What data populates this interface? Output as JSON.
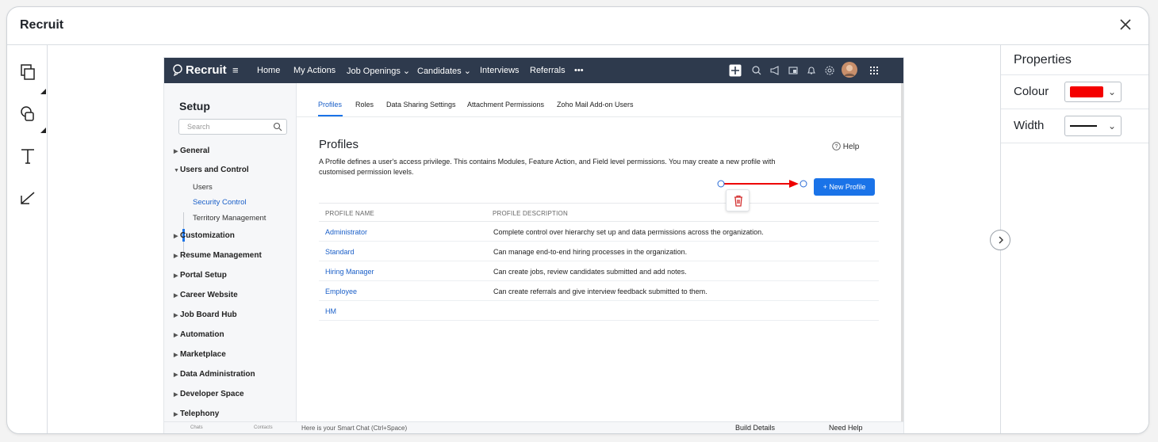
{
  "window": {
    "title": "Recruit",
    "close_icon": "close-icon"
  },
  "toolbar": {
    "tools": [
      "layers-copy-icon",
      "shapes-icon",
      "text-icon",
      "pen-icon"
    ]
  },
  "properties": {
    "title": "Properties",
    "colour_label": "Colour",
    "colour_value": "#f40000",
    "width_label": "Width"
  },
  "zoho": {
    "logo": "Recruit",
    "nav": [
      "Home",
      "My Actions",
      "Job Openings ⌄",
      "Candidates ⌄",
      "Interviews",
      "Referrals",
      "•••"
    ],
    "sidebar": {
      "title": "Setup",
      "search_placeholder": "Search",
      "menu": [
        "General",
        "Users and Control",
        "Customization",
        "Resume Management",
        "Portal Setup",
        "Career Website",
        "Job Board Hub",
        "Automation",
        "Marketplace",
        "Data Administration",
        "Developer Space",
        "Telephony"
      ],
      "submenu": [
        "Users",
        "Security Control",
        "Territory Management"
      ]
    },
    "tabs": [
      "Profiles",
      "Roles",
      "Data Sharing Settings",
      "Attachment Permissions",
      "Zoho Mail Add-on Users"
    ],
    "page_title": "Profiles",
    "description": "A Profile defines a user's access privilege. This contains Modules, Feature Action, and Field level permissions. You may create a new profile with customised permission levels.",
    "help": "Help",
    "new_profile": "+ New Profile",
    "columns": [
      "PROFILE NAME",
      "PROFILE DESCRIPTION"
    ],
    "rows": [
      {
        "name": "Administrator",
        "desc": "Complete control over hierarchy set up and data permissions across the organization."
      },
      {
        "name": "Standard",
        "desc": "Can manage end-to-end hiring processes in the organization."
      },
      {
        "name": "Hiring Manager",
        "desc": "Can create jobs, review candidates submitted and add notes."
      },
      {
        "name": "Employee",
        "desc": "Can create referrals and give interview feedback submitted to them."
      },
      {
        "name": "HM",
        "desc": ""
      }
    ],
    "bottom": {
      "chats": "Chats",
      "contacts": "Contacts",
      "smart_chat": "Here is your Smart Chat (Ctrl+Space)",
      "build_details": "Build Details",
      "need_help": "Need Help"
    }
  }
}
